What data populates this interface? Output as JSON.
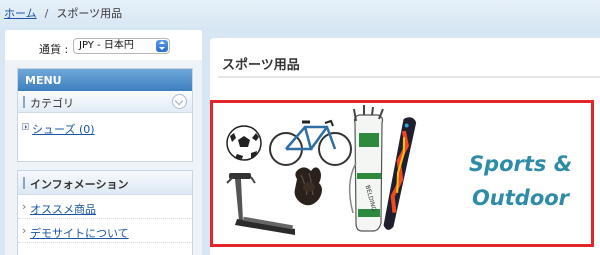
{
  "breadcrumb": {
    "home": "ホーム",
    "separator": "/",
    "current": "スポーツ用品"
  },
  "currency": {
    "label": "通貨 :",
    "selected": "JPY - 日本円"
  },
  "menu": {
    "header": "MENU",
    "category_title": "カテゴリ",
    "items": [
      {
        "label": "シューズ (0)"
      }
    ]
  },
  "info": {
    "header": "インフォメーション",
    "links": [
      {
        "label": "オススメ商品"
      },
      {
        "label": "デモサイトについて"
      }
    ]
  },
  "main": {
    "title": "スポーツ用品"
  },
  "banner": {
    "line1": "Sports &",
    "line2": "Outdoor",
    "bag_text": "BELDING",
    "border_color": "#e3262b",
    "text_color": "#2f8ca6",
    "icons": [
      "soccer-ball-icon",
      "road-bicycle-icon",
      "golf-bag-icon",
      "snowboard-icon",
      "treadmill-icon",
      "baseball-glove-icon"
    ]
  }
}
